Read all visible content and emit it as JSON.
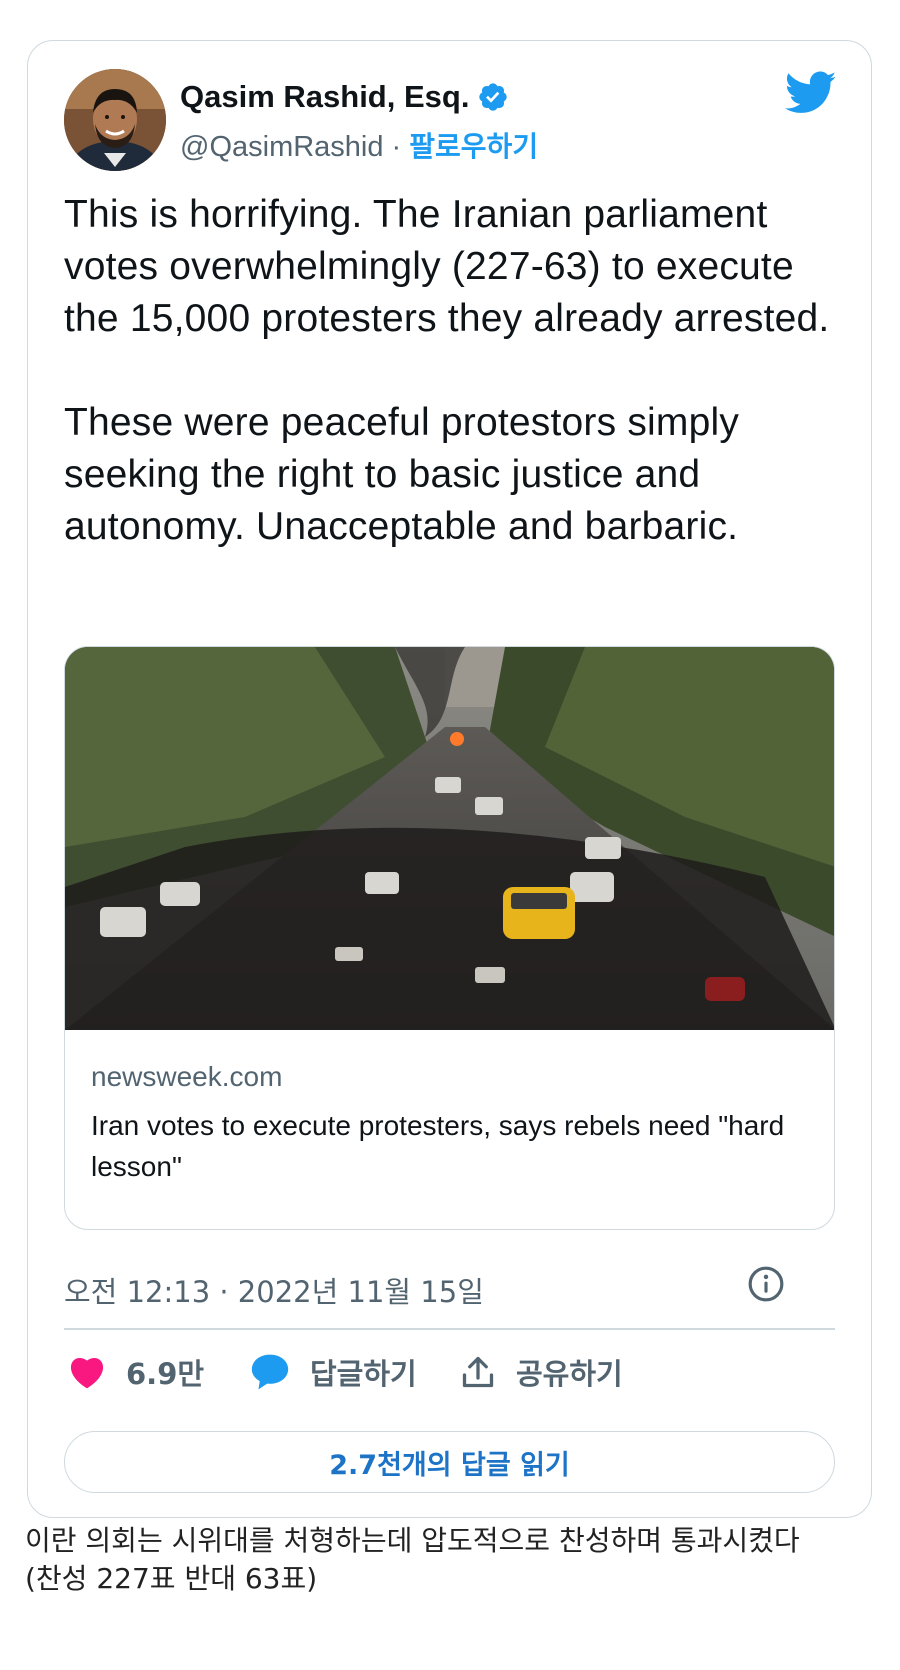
{
  "tweet": {
    "author_name": "Qasim Rashid, Esq.",
    "handle": "@QasimRashid",
    "separator": " · ",
    "follow_label": "팔로우하기",
    "text": "This is horrifying. The Iranian parliament votes overwhelmingly (227-63) to execute the 15,000 protesters they already arrested.\n\nThese were peaceful protestors simply seeking the right to basic justice and autonomy. Unacceptable and barbaric.",
    "timestamp": "오전 12:13 · 2022년 11월 15일"
  },
  "link_card": {
    "domain": "newsweek.com",
    "title": "Iran votes to execute protesters, says rebels need \"hard lesson\""
  },
  "actions": {
    "like_count": "6.9만",
    "reply_label": "답글하기",
    "share_label": "공유하기",
    "read_replies_label": "2.7천개의 답글 읽기"
  },
  "caption": {
    "line1": "이란 의회는 시위대를 처형하는데 압도적으로 찬성하며 통과시켰다",
    "line2": "(찬성 227표 반대 63표)"
  },
  "colors": {
    "twitter_blue": "#1d9bf0",
    "like_pink": "#f91880",
    "reply_blue": "#1d9bf0",
    "secondary_text": "#536471",
    "border": "#cfd9de"
  },
  "icons": {
    "verified": "verified-badge-icon",
    "brand": "twitter-bird-icon",
    "info": "info-icon",
    "like": "heart-icon",
    "reply": "speech-bubble-icon",
    "share": "share-upload-icon"
  }
}
